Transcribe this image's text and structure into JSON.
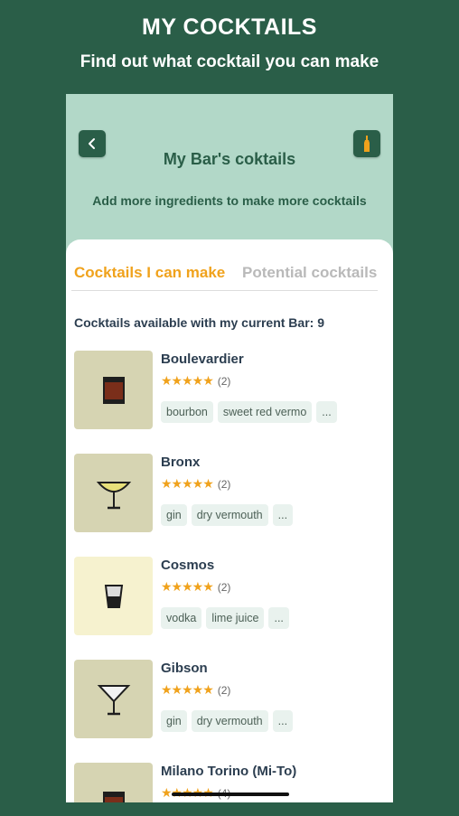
{
  "promo": {
    "title": "MY COCKTAILS",
    "subtitle": "Find out what cocktail you can make"
  },
  "header": {
    "title": "My Bar's coktails",
    "subtitle": "Add more ingredients to make more cocktails",
    "back_icon": "chevron-left-icon",
    "bar_icon": "bottle-icon"
  },
  "tabs": [
    {
      "label": "Cocktails I can make",
      "active": true
    },
    {
      "label": "Potential cocktails",
      "active": false
    }
  ],
  "available_text": "Cocktails available with my current Bar: 9",
  "cocktails": [
    {
      "name": "Boulevardier",
      "stars": "★★★★★",
      "rating_count": "(2)",
      "tags": [
        "bourbon",
        "sweet red vermo",
        "..."
      ],
      "glass": "rocks-glass"
    },
    {
      "name": "Bronx",
      "stars": "★★★★★",
      "rating_count": "(2)",
      "tags": [
        "gin",
        "dry vermouth",
        "..."
      ],
      "glass": "coupe-glass"
    },
    {
      "name": "Cosmos",
      "stars": "★★★★★",
      "rating_count": "(2)",
      "tags": [
        "vodka",
        "lime juice",
        "..."
      ],
      "glass": "shot-glass"
    },
    {
      "name": "Gibson",
      "stars": "★★★★★",
      "rating_count": "(2)",
      "tags": [
        "gin",
        "dry vermouth",
        "..."
      ],
      "glass": "martini-glass"
    },
    {
      "name": "Milano Torino (Mi-To)",
      "stars": "★★★★★",
      "rating_count": "(4)",
      "tags": [],
      "glass": "rocks-glass"
    }
  ],
  "colors": {
    "background": "#2a5e48",
    "header": "#b2d8c8",
    "accent": "#f0a21c"
  }
}
